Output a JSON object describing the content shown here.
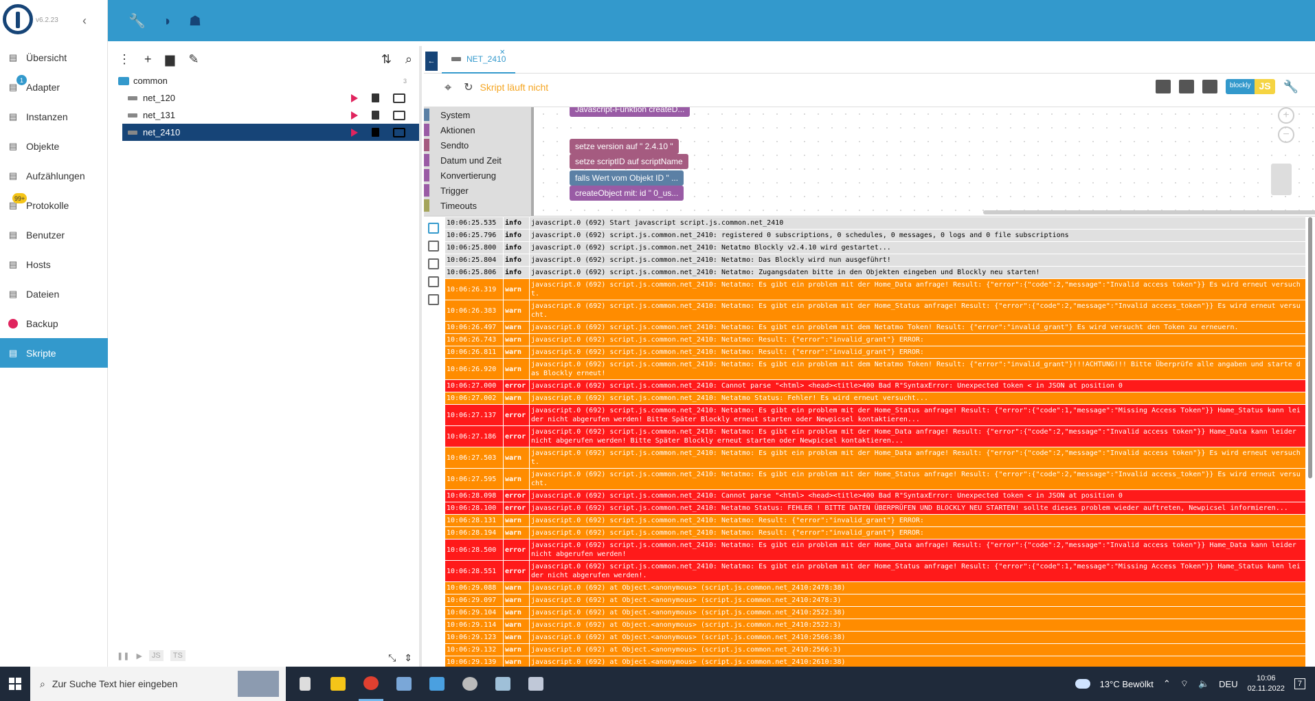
{
  "sidebar": {
    "version": "v6.2.23",
    "items": [
      {
        "label": "Übersicht",
        "icon": "grid-icon"
      },
      {
        "label": "Adapter",
        "icon": "store-icon",
        "badge": "1"
      },
      {
        "label": "Instanzen",
        "icon": "instances-icon"
      },
      {
        "label": "Objekte",
        "icon": "list-icon"
      },
      {
        "label": "Aufzählungen",
        "icon": "enum-icon"
      },
      {
        "label": "Protokolle",
        "icon": "log-icon",
        "badge": "99+"
      },
      {
        "label": "Benutzer",
        "icon": "user-icon"
      },
      {
        "label": "Hosts",
        "icon": "hosts-icon"
      },
      {
        "label": "Dateien",
        "icon": "file-icon"
      },
      {
        "label": "Backup",
        "icon": "backup-icon"
      },
      {
        "label": "Skripte",
        "icon": "script-icon"
      }
    ]
  },
  "tree": {
    "folder": "common",
    "folder_count": "3",
    "scripts": [
      "net_120",
      "net_131",
      "net_2410"
    ]
  },
  "tree_bottom": {
    "js": "JS",
    "ts": "TS"
  },
  "editor": {
    "tab_label": "NET_2410",
    "status": "Skript läuft nicht",
    "blockly_label": "blockly",
    "js_label": "JS"
  },
  "toolbox": [
    {
      "label": "System",
      "color": "#5b80a5"
    },
    {
      "label": "Aktionen",
      "color": "#9a5ba5"
    },
    {
      "label": "Sendto",
      "color": "#a55b80"
    },
    {
      "label": "Datum und Zeit",
      "color": "#9a5ba5"
    },
    {
      "label": "Konvertierung",
      "color": "#9a5ba5"
    },
    {
      "label": "Trigger",
      "color": "#9a5ba5"
    },
    {
      "label": "Timeouts",
      "color": "#a5a55b"
    }
  ],
  "blocks": [
    {
      "text": "Javascript-Funktion createD...",
      "color": "#995ba5"
    },
    {
      "text": "setze version auf \" 2.4.10 \"",
      "color": "#a55b80"
    },
    {
      "text": "setze scriptID auf scriptName",
      "color": "#a55b80"
    },
    {
      "text": "falls Wert vom Objekt ID \" ...",
      "color": "#5b80a5"
    },
    {
      "text": "createObject mit: id \" 0_us...",
      "color": "#995ba5"
    }
  ],
  "logs": [
    {
      "t": "10:06:25.535",
      "l": "info",
      "m": "javascript.0 (692) Start javascript script.js.common.net_2410"
    },
    {
      "t": "10:06:25.796",
      "l": "info",
      "m": "javascript.0 (692) script.js.common.net_2410: registered 0 subscriptions, 0 schedules, 0 messages, 0 logs and 0 file subscriptions"
    },
    {
      "t": "10:06:25.800",
      "l": "info",
      "m": "javascript.0 (692) script.js.common.net_2410: Netatmo Blockly v2.4.10 wird gestartet..."
    },
    {
      "t": "10:06:25.804",
      "l": "info",
      "m": "javascript.0 (692) script.js.common.net_2410: Netatmo: Das Blockly wird nun ausgeführt!"
    },
    {
      "t": "10:06:25.806",
      "l": "info",
      "m": "javascript.0 (692) script.js.common.net_2410: Netatmo: Zugangsdaten bitte in den Objekten eingeben und Blockly neu starten!"
    },
    {
      "t": "10:06:26.319",
      "l": "warn",
      "m": "javascript.0 (692) script.js.common.net_2410: Netatmo: Es gibt ein problem mit der Home_Data anfrage! Result: {\"error\":{\"code\":2,\"message\":\"Invalid access token\"}} Es wird erneut versucht."
    },
    {
      "t": "10:06:26.383",
      "l": "warn",
      "m": "javascript.0 (692) script.js.common.net_2410: Netatmo: Es gibt ein problem mit der Home_Status anfrage! Result: {\"error\":{\"code\":2,\"message\":\"Invalid access_token\"}} Es wird erneut versucht."
    },
    {
      "t": "10:06:26.497",
      "l": "warn",
      "m": "javascript.0 (692) script.js.common.net_2410: Netatmo: Es gibt ein problem mit dem Netatmo Token! Result: {\"error\":\"invalid_grant\"} Es wird versucht den Token zu erneuern."
    },
    {
      "t": "10:06:26.743",
      "l": "warn",
      "m": "javascript.0 (692) script.js.common.net_2410: Netatmo: Result: {\"error\":\"invalid_grant\"} ERROR:"
    },
    {
      "t": "10:06:26.811",
      "l": "warn",
      "m": "javascript.0 (692) script.js.common.net_2410: Netatmo: Result: {\"error\":\"invalid_grant\"} ERROR:"
    },
    {
      "t": "10:06:26.920",
      "l": "warn",
      "m": "javascript.0 (692) script.js.common.net_2410: Netatmo: Es gibt ein problem mit dem Netatmo Token! Result: {\"error\":\"invalid_grant\"}!!!ACHTUNG!!! Bitte Überprüfe alle angaben und starte das Blockly erneut!"
    },
    {
      "t": "10:06:27.000",
      "l": "error",
      "m": "javascript.0 (692) script.js.common.net_2410: Cannot parse \"<html> <head><title>400 Bad R\"SyntaxError: Unexpected token < in JSON at position 0"
    },
    {
      "t": "10:06:27.002",
      "l": "warn",
      "m": "javascript.0 (692) script.js.common.net_2410: Netatmo Status: Fehler! Es wird erneut versucht..."
    },
    {
      "t": "10:06:27.137",
      "l": "error",
      "m": "javascript.0 (692) script.js.common.net_2410: Netatmo: Es gibt ein problem mit der Home_Status anfrage! Result: {\"error\":{\"code\":1,\"message\":\"Missing Access Token\"}} Hame_Status kann leider nicht abgerufen werden! Bitte Später Blockly erneut starten oder Newpicsel kontaktieren..."
    },
    {
      "t": "10:06:27.186",
      "l": "error",
      "m": "javascript.0 (692) script.js.common.net_2410: Netatmo: Es gibt ein problem mit der Home_Data anfrage! Result: {\"error\":{\"code\":2,\"message\":\"Invalid access token\"}} Hame_Data kann leider nicht abgerufen werden! Bitte Später Blockly erneut starten oder Newpicsel kontaktieren..."
    },
    {
      "t": "10:06:27.503",
      "l": "warn",
      "m": "javascript.0 (692) script.js.common.net_2410: Netatmo: Es gibt ein problem mit der Home_Data anfrage! Result: {\"error\":{\"code\":2,\"message\":\"Invalid access token\"}} Es wird erneut versucht."
    },
    {
      "t": "10:06:27.595",
      "l": "warn",
      "m": "javascript.0 (692) script.js.common.net_2410: Netatmo: Es gibt ein problem mit der Home_Status anfrage! Result: {\"error\":{\"code\":2,\"message\":\"Invalid access_token\"}} Es wird erneut versucht."
    },
    {
      "t": "10:06:28.098",
      "l": "error",
      "m": "javascript.0 (692) script.js.common.net_2410: Cannot parse \"<html> <head><title>400 Bad R\"SyntaxError: Unexpected token < in JSON at position 0"
    },
    {
      "t": "10:06:28.100",
      "l": "error",
      "m": "javascript.0 (692) script.js.common.net_2410: Netatmo Status: FEHLER ! BITTE DATEN ÜBERPRÜFEN UND BLOCKLY NEU STARTEN! sollte dieses problem wieder auftreten, Newpicsel informieren..."
    },
    {
      "t": "10:06:28.131",
      "l": "warn",
      "m": "javascript.0 (692) script.js.common.net_2410: Netatmo: Result: {\"error\":\"invalid_grant\"} ERROR:"
    },
    {
      "t": "10:06:28.194",
      "l": "warn",
      "m": "javascript.0 (692) script.js.common.net_2410: Netatmo: Result: {\"error\":\"invalid_grant\"} ERROR:"
    },
    {
      "t": "10:06:28.500",
      "l": "error",
      "m": "javascript.0 (692) script.js.common.net_2410: Netatmo: Es gibt ein problem mit der Home_Data anfrage! Result: {\"error\":{\"code\":2,\"message\":\"Invalid access token\"}} Hame_Data kann leider nicht abgerufen werden!"
    },
    {
      "t": "10:06:28.551",
      "l": "error",
      "m": "javascript.0 (692) script.js.common.net_2410: Netatmo: Es gibt ein problem mit der Home_Status anfrage! Result: {\"error\":{\"code\":1,\"message\":\"Missing Access Token\"}} Hame_Status kann leider nicht abgerufen werden!."
    },
    {
      "t": "10:06:29.088",
      "l": "warn",
      "m": "javascript.0 (692) at Object.<anonymous> (script.js.common.net_2410:2478:38)"
    },
    {
      "t": "10:06:29.097",
      "l": "warn",
      "m": "javascript.0 (692) at Object.<anonymous> (script.js.common.net_2410:2478:3)"
    },
    {
      "t": "10:06:29.104",
      "l": "warn",
      "m": "javascript.0 (692) at Object.<anonymous> (script.js.common.net_2410:2522:38)"
    },
    {
      "t": "10:06:29.114",
      "l": "warn",
      "m": "javascript.0 (692) at Object.<anonymous> (script.js.common.net_2410:2522:3)"
    },
    {
      "t": "10:06:29.123",
      "l": "warn",
      "m": "javascript.0 (692) at Object.<anonymous> (script.js.common.net_2410:2566:38)"
    },
    {
      "t": "10:06:29.132",
      "l": "warn",
      "m": "javascript.0 (692) at Object.<anonymous> (script.js.common.net_2410:2566:3)"
    },
    {
      "t": "10:06:29.139",
      "l": "warn",
      "m": "javascript.0 (692) at Object.<anonymous> (script.js.common.net_2410:2610:38)"
    }
  ],
  "taskbar": {
    "search_placeholder": "Zur Suche Text hier eingeben",
    "weather": "13°C  Bewölkt",
    "lang": "DEU",
    "time": "10:06",
    "date": "02.11.2022",
    "notifications": "7"
  }
}
